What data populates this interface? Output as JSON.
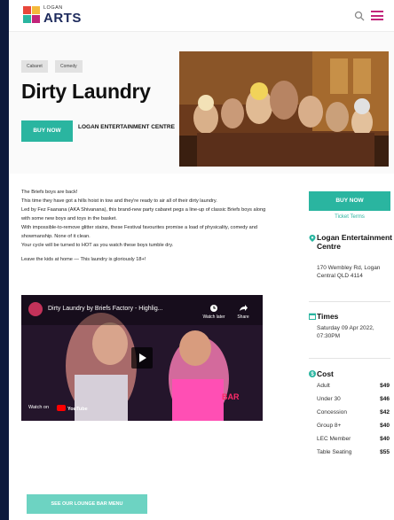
{
  "brand": {
    "small": "LOGAN",
    "big": "ARTS"
  },
  "event": {
    "tags": [
      "Cabaret",
      "Comedy"
    ],
    "title": "Dirty Laundry",
    "buy_label": "BUY NOW",
    "venue_short": "LOGAN ENTERTAINMENT CENTRE"
  },
  "description": [
    "The Briefs boys are back!",
    "This time they have got a hills hoist in tow and they're ready to air all of their dirty laundry.",
    "Led by Fez Faanana (AKA Shivanana), this brand-new party cabaret pegs a line-up of classic Briefs boys along with some new boys and toys in the basket.",
    "With impossible-to-remove glitter stains, these Festival favourites promise a load of physicality, comedy and showmanship. None of it clean.",
    "Your cycle will be turned to HOT as you watch these boys tumble dry.",
    "Leave the kids at home — This laundry is gloriously 18+!"
  ],
  "video": {
    "title": "Dirty Laundry by Briefs Factory - Highlig...",
    "watch_later": "Watch later",
    "share": "Share",
    "watch_on": "Watch on",
    "youtube": "YouTube",
    "bar_sign": "BAR"
  },
  "lounge_label": "SEE OUR LOUNGE BAR MENU",
  "sidebar": {
    "buy_label": "BUY NOW",
    "terms": "Ticket Terms",
    "venue_name": "Logan Entertainment Centre",
    "address": "170 Wembley Rd, Logan Central QLD 4114",
    "times_heading": "Times",
    "times_value": "Saturday 09 Apr 2022, 07:30PM",
    "cost_heading": "Cost",
    "costs": [
      {
        "label": "Adult",
        "price": "$49"
      },
      {
        "label": "Under 30",
        "price": "$46"
      },
      {
        "label": "Concession",
        "price": "$42"
      },
      {
        "label": "Group 8+",
        "price": "$40"
      },
      {
        "label": "LEC Member",
        "price": "$40"
      },
      {
        "label": "Table Seating",
        "price": "$55"
      }
    ]
  },
  "colors": {
    "accent": "#2ab5a0",
    "menu": "#c2247a",
    "brand": "#1d2a5c"
  },
  "icons": [
    "search-icon",
    "menu-icon",
    "location-pin-icon",
    "calendar-icon",
    "dollar-icon",
    "play-icon",
    "clock-icon",
    "share-icon"
  ]
}
